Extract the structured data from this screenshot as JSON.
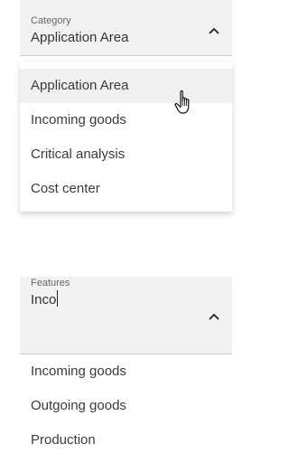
{
  "dropdown1": {
    "label": "Category",
    "value": "Application Area",
    "options": [
      "Application Area",
      "Incoming goods",
      "Critical analysis",
      "Cost center"
    ]
  },
  "dropdown2": {
    "label": "Features",
    "input_value": "Inco",
    "options": [
      "Incoming goods",
      "Outgoing goods",
      "Production"
    ]
  },
  "icons": {
    "chevron": "chevron-up-icon",
    "cursor": "hand-pointer-cursor-icon"
  }
}
